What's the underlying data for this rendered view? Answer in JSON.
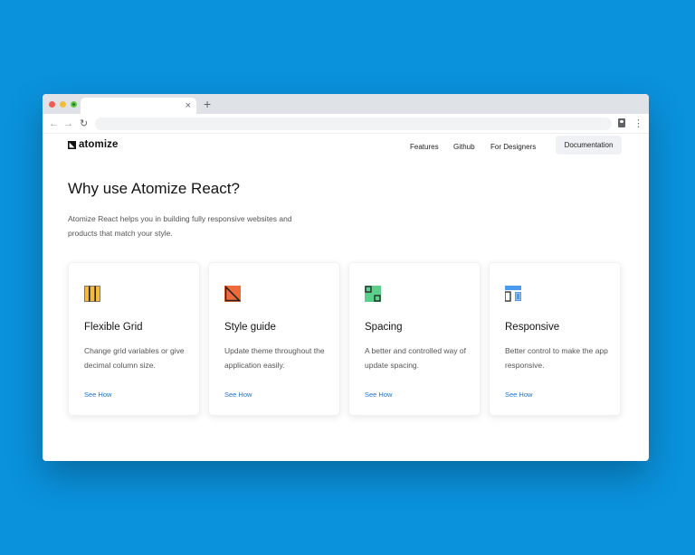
{
  "browser": {
    "tab_close": "×",
    "tab_new": "+",
    "back": "←",
    "forward": "→",
    "reload": "↻",
    "menu": "⋮",
    "icons": [
      "close-icon",
      "plus-icon",
      "arrow-left-icon",
      "arrow-right-icon",
      "reload-icon",
      "profile-icon",
      "kebab-menu-icon"
    ]
  },
  "site": {
    "logo_text": "atomize",
    "nav": {
      "features": "Features",
      "github": "Github",
      "designers": "For Designers"
    },
    "docs_button": "Documentation"
  },
  "hero": {
    "heading": "Why use Atomize React?",
    "intro": "Atomize React helps you in building fully responsive websites and products that match your style."
  },
  "cards": [
    {
      "title": "Flexible Grid",
      "desc": "Change grid variables or give decimal column size.",
      "link": "See How",
      "icon": "grid-columns-icon",
      "color": "#f6b93b"
    },
    {
      "title": "Style guide",
      "desc": "Update theme throughout the application easily.",
      "link": "See How",
      "icon": "style-guide-icon",
      "color": "#ee6b3b"
    },
    {
      "title": "Spacing",
      "desc": "A better and controlled way of update spacing.",
      "link": "See How",
      "icon": "spacing-icon",
      "color": "#5ccf8a"
    },
    {
      "title": "Responsive",
      "desc": "Better control to make the app responsive.",
      "link": "See How",
      "icon": "responsive-icon",
      "color": "#4a9cf0"
    }
  ],
  "colors": {
    "background": "#0a92dd",
    "link": "#1b72d2"
  }
}
